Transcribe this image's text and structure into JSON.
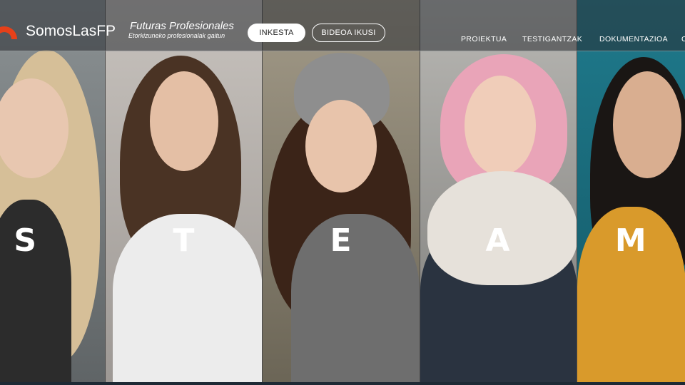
{
  "header": {
    "brand": "SomosLasFP",
    "tagline_title": "Futuras Profesionales",
    "tagline_sub": "Etorkizuneko profesionalak gaitun",
    "buttons": {
      "inkesta": "INKESTA",
      "bideoa": "BIDEOA IKUSI"
    },
    "nav": [
      "PROIEKTUA",
      "TESTIGANTZAK",
      "DOKUMENTAZIOA",
      "C"
    ],
    "logo_color": "#e64019"
  },
  "panels": [
    {
      "letter": "S",
      "bg": "#7d8486",
      "hair": "#d8c09a",
      "skin": "#e8c7b0",
      "top": "#2c2c2c"
    },
    {
      "letter": "T",
      "bg": "#b9b4b0",
      "hair": "#4a3324",
      "skin": "#e4bfa5",
      "top": "#ececec"
    },
    {
      "letter": "E",
      "bg": "#8f8878",
      "hair": "#3b2418",
      "skin": "#e8c4ab",
      "top": "#6e6e6e"
    },
    {
      "letter": "A",
      "bg": "#a8a7a3",
      "hair": "#e9a4b8",
      "skin": "#f0cdb9",
      "top": "#e6e1da"
    },
    {
      "letter": "M",
      "bg": "#1d6d7e",
      "hair": "#1a1614",
      "skin": "#d9ae90",
      "top": "#d99a2b"
    }
  ]
}
